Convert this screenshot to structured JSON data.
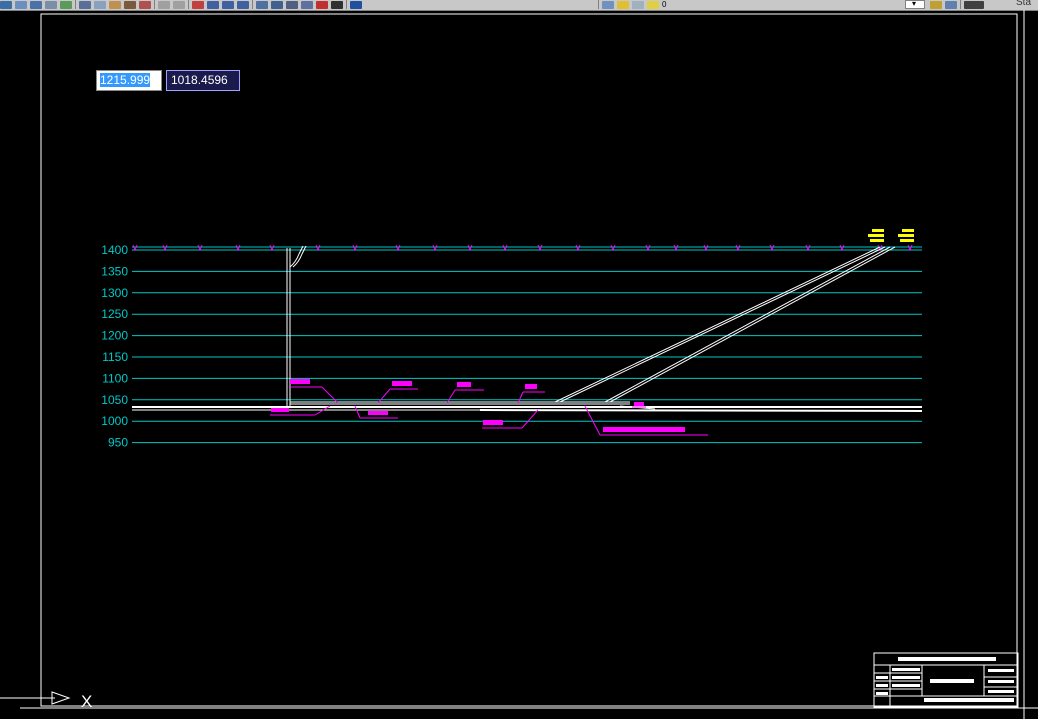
{
  "toolbar": {
    "icons": [
      "new-icon",
      "open-icon",
      "save-icon",
      "plot-icon",
      "preview-icon",
      "cut-icon",
      "copy-icon",
      "paste-icon",
      "match-icon",
      "brush-icon",
      "undo-icon",
      "redo-icon",
      "pan-icon",
      "zoom-realtime-icon",
      "zoom-window-icon",
      "zoom-previous-icon",
      "properties-icon",
      "designcenter-icon",
      "toolpalette-icon",
      "sheetset-icon",
      "markup-icon",
      "calc-icon",
      "help-icon",
      "layer-manager-icon",
      "layer-state-icon",
      "layer-state-icon-2",
      "layer-previous-icon",
      "layer-iso-icon",
      "match-properties-icon"
    ],
    "layer_value": "0",
    "status_text": "Sta"
  },
  "coordinates": {
    "x_value": "1215.999",
    "y_value": "1018.4596"
  },
  "drawing": {
    "elevation_labels": [
      "1400",
      "1350",
      "1300",
      "1250",
      "1200",
      "1150",
      "1100",
      "1050",
      "1000",
      "950"
    ],
    "colors": {
      "background": "#000000",
      "grid": "#00c8c8",
      "profile": "#ffffff",
      "annotation": "#ff00ff",
      "marker": "#ffff00",
      "title_block": "#ffffff"
    }
  },
  "ucs": {
    "x_label": "X"
  }
}
